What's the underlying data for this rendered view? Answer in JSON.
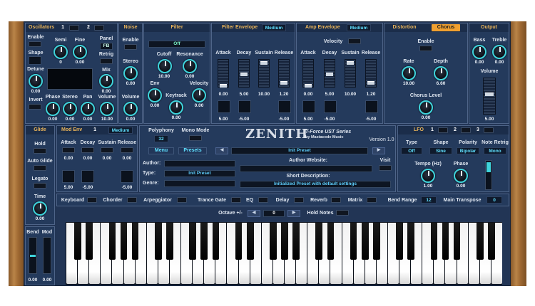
{
  "osc": {
    "title": "Oscillators",
    "n1": "1",
    "n2": "2",
    "enable": "Enable",
    "shape": "Shape",
    "detune": "Detune",
    "detune_v": "0.00",
    "invert": "Invert",
    "semi": "Semi",
    "semi_v": "0",
    "fine": "Fine",
    "fine_v": "0.00",
    "panel": "Panel",
    "fb": "FB",
    "retrig": "Retrig",
    "mix": "Mix",
    "mix_v": "0.00",
    "phase": "Phase",
    "phase_v": "0.00",
    "stereo": "Stereo",
    "stereo_v": "0.00",
    "pan": "Pan",
    "pan_v": "0.00",
    "volume": "Volume",
    "volume_v": "10.00"
  },
  "noise": {
    "title": "Noise",
    "enable": "Enable",
    "stereo": "Stereo",
    "stereo_v": "0.00",
    "volume": "Volume",
    "volume_v": "0.00"
  },
  "filter": {
    "title": "Filter",
    "type": "Off",
    "cutoff": "Cutoff",
    "cutoff_v": "10.00",
    "res": "Resonance",
    "res_v": "0.00",
    "env": "Env",
    "env_v": "0.00",
    "keytrack": "Keytrack",
    "keytrack_v": "0.00",
    "velocity": "Velocity",
    "velocity_v": "0.00"
  },
  "fenv": {
    "title": "Filter Envelope",
    "mode": "Medium",
    "attack": "Attack",
    "decay": "Decay",
    "sustain": "Sustain",
    "release": "Release",
    "a_v": "0.00",
    "d_v": "5.00",
    "s_v": "10.00",
    "r_v": "1.20",
    "c1": "5.00",
    "c2": "-5.00",
    "c3": "-5.00"
  },
  "aenv": {
    "title": "Amp Envelope",
    "mode": "Medium",
    "velocity": "Velocity",
    "attack": "Attack",
    "decay": "Decay",
    "sustain": "Sustain",
    "release": "Release",
    "a_v": "0.00",
    "d_v": "5.00",
    "s_v": "10.00",
    "r_v": "1.20",
    "c1": "5.00",
    "c2": "-5.00",
    "c3": "-5.00"
  },
  "fx": {
    "distortion": "Distortion",
    "chorus": "Chorus",
    "enable": "Enable",
    "rate": "Rate",
    "rate_v": "10.00",
    "depth": "Depth",
    "depth_v": "6.60",
    "level": "Chorus Level",
    "level_v": "0.00"
  },
  "output": {
    "title": "Output",
    "bass": "Bass",
    "bass_v": "0.00",
    "treble": "Treble",
    "treble_v": "0.00",
    "volume": "Volume",
    "volume_v": "5.00"
  },
  "glide": {
    "title": "Glide",
    "hold": "Hold",
    "auto": "Auto Glide",
    "legato": "Legato",
    "time": "Time",
    "time_v": "0.00"
  },
  "modenv": {
    "title": "Mod Env",
    "n": "1",
    "mode": "Medium",
    "attack": "Attack",
    "decay": "Decay",
    "sustain": "Sustain",
    "release": "Release",
    "a_v": "0.00",
    "d_v": "0.00",
    "s_v": "0.00",
    "r_v": "0.00",
    "c1": "5.00",
    "c2": "-5.00",
    "c3": "-5.00"
  },
  "poly": {
    "label": "Polyphony",
    "value": "32",
    "mono": "Mono Mode"
  },
  "brand": {
    "name": "ZENITH",
    "line1": "T-Force UST Series",
    "line2": "by Mastacode Music",
    "version": "Version 1.0"
  },
  "preset": {
    "menu": "Menu",
    "presets": "Presets",
    "name": "Init Preset",
    "author": "Author:",
    "type": "Type:",
    "type_v": "Init Preset",
    "genre": "Genre:",
    "website": "Author Website:",
    "visit": "Visit",
    "short": "Short Description:",
    "desc": "Initialized Preset with default settings"
  },
  "lfo": {
    "title": "LFO",
    "n1": "1",
    "n2": "2",
    "n3": "3",
    "type": "Type",
    "type_v": "Off",
    "shape": "Shape",
    "shape_v": "Sine",
    "polarity": "Polarity",
    "polarity_v": "Bipolar",
    "retrig": "Note Retrig",
    "retrig_v": "Mono",
    "tempo": "Tempo (Hz)",
    "tempo_v": "1.00",
    "phase": "Phase",
    "phase_v": "0.00"
  },
  "tabs": {
    "keyboard": "Keyboard",
    "chorder": "Chorder",
    "arp": "Arpeggiator",
    "trance": "Trance Gate",
    "eq": "EQ",
    "delay": "Delay",
    "reverb": "Reverb",
    "matrix": "Matrix",
    "bend": "Bend Range",
    "bend_v": "12",
    "transpose": "Main Transpose",
    "transpose_v": "0"
  },
  "kb": {
    "octave": "Octave +/-",
    "octave_v": "0",
    "hold": "Hold Notes"
  },
  "wheels": {
    "bend": "Bend",
    "mod": "Mod",
    "bend_v": "0.00",
    "mod_v": "0.00"
  },
  "colors": {
    "panel": "#223555",
    "accent": "#3fd4dc",
    "header_text": "#e8b35a",
    "chorus": "#f0a030",
    "wood": "#b98448"
  }
}
